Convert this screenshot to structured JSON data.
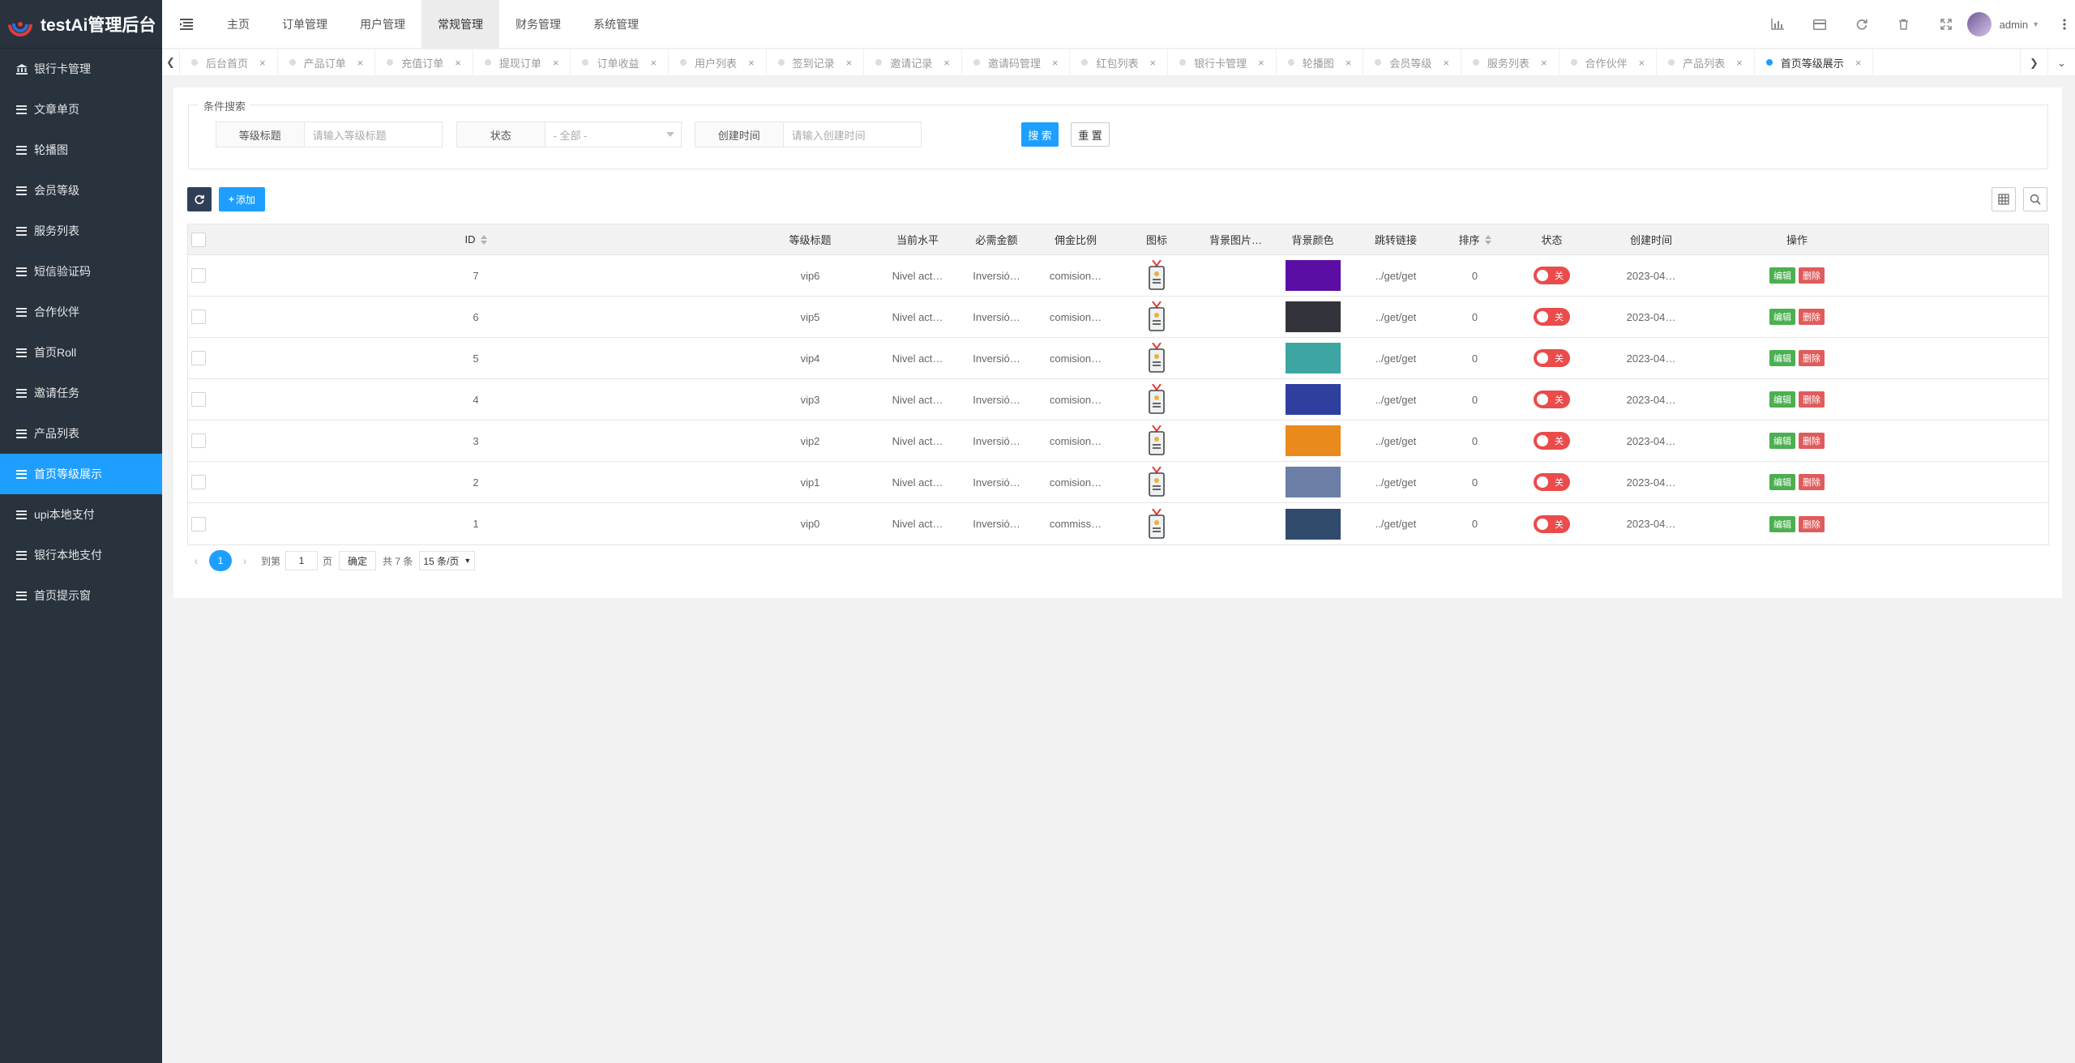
{
  "app": {
    "title": "testAi管理后台"
  },
  "sidebar": {
    "items": [
      {
        "label": "银行卡管理",
        "icon": "bank-icon"
      },
      {
        "label": "文章单页",
        "icon": "list-icon"
      },
      {
        "label": "轮播图",
        "icon": "list-icon"
      },
      {
        "label": "会员等级",
        "icon": "list-icon"
      },
      {
        "label": "服务列表",
        "icon": "list-icon"
      },
      {
        "label": "短信验证码",
        "icon": "list-icon"
      },
      {
        "label": "合作伙伴",
        "icon": "list-icon"
      },
      {
        "label": "首页Roll",
        "icon": "list-icon"
      },
      {
        "label": "邀请任务",
        "icon": "list-icon"
      },
      {
        "label": "产品列表",
        "icon": "list-icon"
      },
      {
        "label": "首页等级展示",
        "icon": "list-icon",
        "active": true
      },
      {
        "label": "upi本地支付",
        "icon": "list-icon"
      },
      {
        "label": "银行本地支付",
        "icon": "list-icon"
      },
      {
        "label": "首页提示窗",
        "icon": "list-icon"
      }
    ]
  },
  "header": {
    "nav": [
      "主页",
      "订单管理",
      "用户管理",
      "常规管理",
      "财务管理",
      "系统管理"
    ],
    "active_nav": "常规管理",
    "user": "admin"
  },
  "tabs": [
    "后台首页",
    "产品订单",
    "充值订单",
    "提现订单",
    "订单收益",
    "用户列表",
    "签到记录",
    "邀请记录",
    "邀请码管理",
    "红包列表",
    "银行卡管理",
    "轮播图",
    "会员等级",
    "服务列表",
    "合作伙伴",
    "产品列表",
    "首页等级展示"
  ],
  "active_tab": "首页等级展示",
  "search": {
    "legend": "条件搜索",
    "level_title_label": "等级标题",
    "level_title_placeholder": "请输入等级标题",
    "status_label": "状态",
    "status_value": "- 全部 -",
    "created_label": "创建时间",
    "created_placeholder": "请输入创建时间",
    "search_btn": "搜 索",
    "reset_btn": "重 置"
  },
  "toolbar": {
    "add_label": "添加"
  },
  "table": {
    "columns": [
      "ID",
      "等级标题",
      "当前水平",
      "必需金额",
      "佣金比例",
      "图标",
      "背景图片…",
      "背景颜色",
      "跳转链接",
      "排序",
      "状态",
      "创建时间",
      "操作"
    ],
    "rows": [
      {
        "id": "7",
        "title": "vip6",
        "level": "Nivel act…",
        "amount": "Inversió…",
        "ratio": "comision…",
        "color": "#5a0ea3",
        "link": "../get/get",
        "sort": "0",
        "status": "关",
        "created": "2023-04…"
      },
      {
        "id": "6",
        "title": "vip5",
        "level": "Nivel act…",
        "amount": "Inversió…",
        "ratio": "comision…",
        "color": "#33333b",
        "link": "../get/get",
        "sort": "0",
        "status": "关",
        "created": "2023-04…"
      },
      {
        "id": "5",
        "title": "vip4",
        "level": "Nivel act…",
        "amount": "Inversió…",
        "ratio": "comision…",
        "color": "#3ea6a2",
        "link": "../get/get",
        "sort": "0",
        "status": "关",
        "created": "2023-04…"
      },
      {
        "id": "4",
        "title": "vip3",
        "level": "Nivel act…",
        "amount": "Inversió…",
        "ratio": "comision…",
        "color": "#2e3f9e",
        "link": "../get/get",
        "sort": "0",
        "status": "关",
        "created": "2023-04…"
      },
      {
        "id": "3",
        "title": "vip2",
        "level": "Nivel act…",
        "amount": "Inversió…",
        "ratio": "comision…",
        "color": "#ea8a1c",
        "link": "../get/get",
        "sort": "0",
        "status": "关",
        "created": "2023-04…"
      },
      {
        "id": "2",
        "title": "vip1",
        "level": "Nivel act…",
        "amount": "Inversió…",
        "ratio": "comision…",
        "color": "#6b7fa6",
        "link": "../get/get",
        "sort": "0",
        "status": "关",
        "created": "2023-04…"
      },
      {
        "id": "1",
        "title": "vip0",
        "level": "Nivel act…",
        "amount": "Inversió…",
        "ratio": "commiss…",
        "color": "#2f4a6b",
        "link": "../get/get",
        "sort": "0",
        "status": "关",
        "created": "2023-04…"
      }
    ],
    "edit_label": "编辑",
    "delete_label": "删除"
  },
  "pager": {
    "current": "1",
    "goto_label": "到第",
    "page_value": "1",
    "page_unit": "页",
    "confirm": "确定",
    "total": "共 7 条",
    "page_size": "15 条/页"
  }
}
